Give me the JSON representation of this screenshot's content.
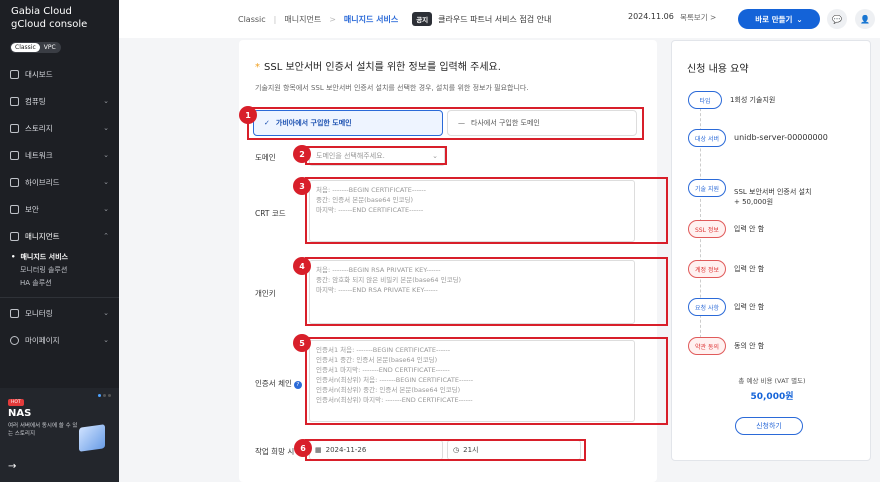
{
  "brand": {
    "line1": "Gabia Cloud",
    "line2": "gCloud console"
  },
  "env": {
    "a": "Classic",
    "b": "VPC"
  },
  "sidebar": {
    "items": [
      {
        "label": "대시보드",
        "icon": "dashboard-icon"
      },
      {
        "label": "컴퓨팅",
        "icon": "compute-icon"
      },
      {
        "label": "스토리지",
        "icon": "storage-icon"
      },
      {
        "label": "네트워크",
        "icon": "network-icon"
      },
      {
        "label": "하이브리드",
        "icon": "hybrid-icon"
      },
      {
        "label": "보안",
        "icon": "shield-icon"
      },
      {
        "label": "매니지먼트",
        "icon": "grid-icon"
      }
    ],
    "sub": [
      "매니지드 서비스",
      "모니터링 솔루션",
      "HA 솔루션"
    ],
    "bottom": [
      {
        "label": "모니터링",
        "icon": "monitor-icon"
      },
      {
        "label": "마이페이지",
        "icon": "user-icon"
      }
    ]
  },
  "promo": {
    "hot": "HOT",
    "title": "NAS",
    "desc": "여러 서버에서 동시에 쓸 수 있는 스토리지",
    "arrow": "→"
  },
  "topbar": {
    "crumbs": [
      "Classic",
      "매니지먼트",
      "매니지드 서비스"
    ],
    "notice_tag": "공지",
    "notice": "클라우드 파트너 서비스 점검 안내",
    "date": "2024.11.06",
    "list": "목록보기 >",
    "make": "바로 만들기"
  },
  "form": {
    "heading": "SSL 보안서버 인증서 설치를 위한 정보를 입력해 주세요.",
    "sub": "기술지원 항목에서 SSL 보안서버 인증서 설치를 선택한 경우, 설치를 위한 정보가 필요합니다.",
    "opt_gabia": "가비아에서 구입한 도메인",
    "opt_other": "타사에서 구입한 도메인",
    "domain_label": "도메인",
    "domain_placeholder": "도메인을 선택해주세요.",
    "crt_label": "CRT 코드",
    "crt_placeholder": "처음: -------BEGIN CERTIFICATE------\n중간: 인증서 본문(base64 인코딩)\n마지막: ------END CERTIFICATE------",
    "key_label": "개인키",
    "key_placeholder": "처음: -------BEGIN RSA PRIVATE KEY------\n중간: 암호화 되지 않은 비밀키 본문(base64 인코딩)\n마지막: ------END RSA PRIVATE KEY------",
    "chain_label": "인증서 체인",
    "chain_placeholder": "인증서1 처음: -------BEGIN CERTIFICATE------\n인증서1 중간: 인증서 본문(base64 인코딩)\n인증서1 마지막: -------END CERTIFICATE------\n인증서n(최상위) 처음: -------BEGIN CERTIFICATE------\n인증서n(최상위) 중간: 인증서 본문(base64 인코딩)\n인증서n(최상위) 마지막: -------END CERTIFICATE------",
    "date_label": "작업 희망 시",
    "date_value": "2024-11-26",
    "time_value": "21시"
  },
  "badges": [
    "1",
    "2",
    "3",
    "4",
    "5",
    "6"
  ],
  "summary": {
    "title": "신청 내용 요약",
    "steps": [
      {
        "pill": "타입",
        "value": "1회성 기술지원",
        "warn": false
      },
      {
        "pill": "대상 서버",
        "value": "unidb-server-00000000",
        "warn": false
      },
      {
        "pill": "기술 지원",
        "value": "SSL 보안서버 인증서 설치\n+ 50,000원",
        "warn": false
      },
      {
        "pill": "SSL 정보",
        "value": "입력 안 함",
        "warn": true
      },
      {
        "pill": "계정 정보",
        "value": "입력 안 함",
        "warn": true
      },
      {
        "pill": "요청 사항",
        "value": "입력 안 함",
        "warn": false
      },
      {
        "pill": "약관 동의",
        "value": "동의 안 함",
        "warn": true
      }
    ],
    "total_label": "총 예상 비용 (VAT 별도)",
    "total": "50,000원",
    "apply": "신청하기"
  },
  "colors": {
    "accent": "#1463d8",
    "highlight": "#d81f2a",
    "sidebar": "#1d1f24"
  }
}
